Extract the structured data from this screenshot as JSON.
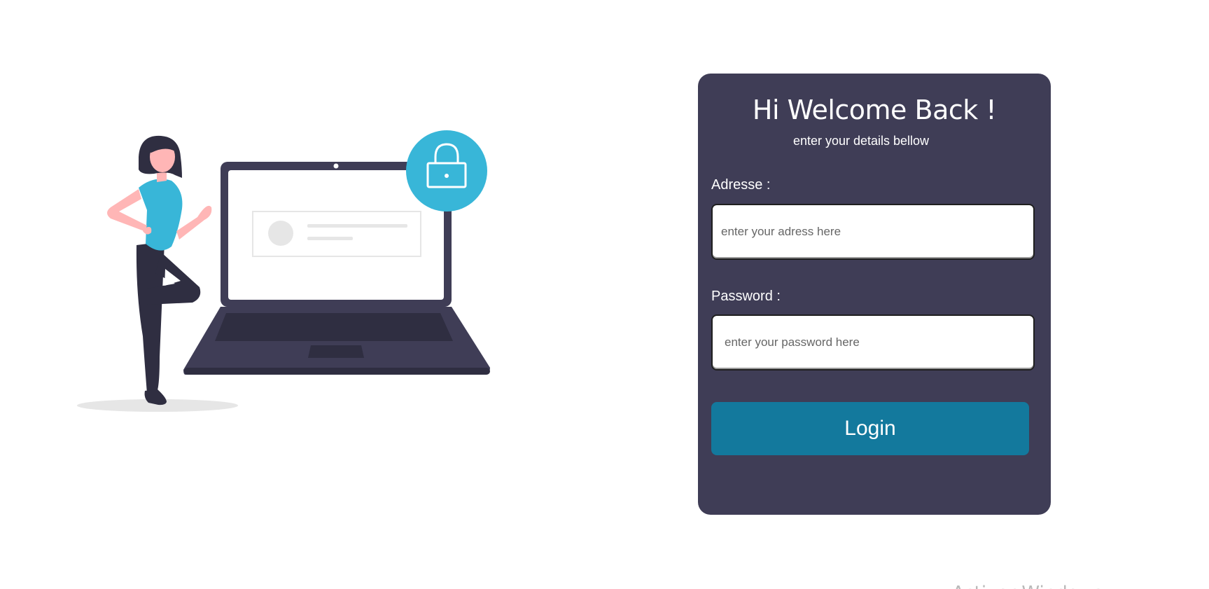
{
  "login_card": {
    "title": "Hi Welcome Back !",
    "subtitle": "enter your details bellow",
    "address_label": "Adresse :",
    "address_placeholder": "enter your adress here",
    "password_label": "Password :",
    "password_placeholder": "enter your password here",
    "login_label": "Login"
  },
  "watermark": {
    "text": "Activer Windows"
  },
  "colors": {
    "card_background": "#3f3d56",
    "button_background": "#13799d",
    "lock_circle": "#38b6d8",
    "shirt": "#38b6d8",
    "skin": "#ffb6b6",
    "dark": "#2f2e41"
  },
  "icons": {
    "illustration": "woman-with-laptop-illustration",
    "lock": "padlock-icon"
  }
}
